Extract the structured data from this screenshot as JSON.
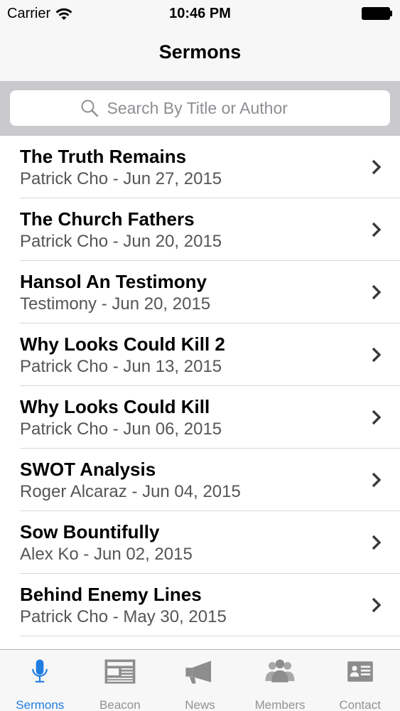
{
  "status_bar": {
    "carrier": "Carrier",
    "time": "10:46 PM"
  },
  "nav": {
    "title": "Sermons"
  },
  "search": {
    "placeholder": "Search By Title or Author"
  },
  "sermons": [
    {
      "title": "The Truth Remains",
      "subtitle": "Patrick Cho - Jun 27, 2015"
    },
    {
      "title": "The Church Fathers",
      "subtitle": "Patrick Cho - Jun 20, 2015"
    },
    {
      "title": "Hansol An Testimony",
      "subtitle": "Testimony - Jun 20, 2015"
    },
    {
      "title": "Why Looks Could Kill 2",
      "subtitle": "Patrick Cho - Jun 13, 2015"
    },
    {
      "title": "Why Looks Could Kill",
      "subtitle": "Patrick Cho - Jun 06, 2015"
    },
    {
      "title": "SWOT Analysis",
      "subtitle": "Roger Alcaraz - Jun 04, 2015"
    },
    {
      "title": "Sow Bountifully",
      "subtitle": "Alex Ko - Jun 02, 2015"
    },
    {
      "title": "Behind Enemy Lines",
      "subtitle": "Patrick Cho - May 30, 2015"
    }
  ],
  "tabs": [
    {
      "label": "Sermons",
      "icon": "microphone-icon",
      "active": true
    },
    {
      "label": "Beacon",
      "icon": "newspaper-icon",
      "active": false
    },
    {
      "label": "News",
      "icon": "megaphone-icon",
      "active": false
    },
    {
      "label": "Members",
      "icon": "people-icon",
      "active": false
    },
    {
      "label": "Contact",
      "icon": "contact-card-icon",
      "active": false
    }
  ],
  "colors": {
    "accent": "#1f7de0",
    "inactive": "#929292",
    "search_bg": "#c9c9ce"
  }
}
